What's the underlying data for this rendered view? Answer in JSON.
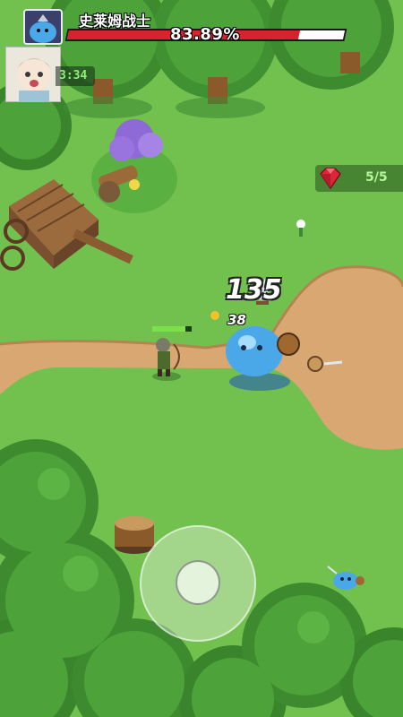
{
  "boss": {
    "name": "史莱姆战士",
    "hp_percent_text": "83.89%",
    "hp_fraction": 0.8389,
    "portrait_icon": "slime-warrior-icon"
  },
  "player": {
    "avatar_icon": "player-avatar-icon",
    "timer": "3:34",
    "hp_fraction": 0.85
  },
  "gems": {
    "icon": "red-gem-icon",
    "count_text": "5/5"
  },
  "damage": {
    "big": "135",
    "small": "38"
  },
  "controls": {
    "joystick_icon": "virtual-joystick"
  },
  "colors": {
    "grass": "#6fbf4b",
    "dirt": "#d9a872",
    "boss_hp": "#d8232a",
    "slime": "#4aa8e8"
  }
}
